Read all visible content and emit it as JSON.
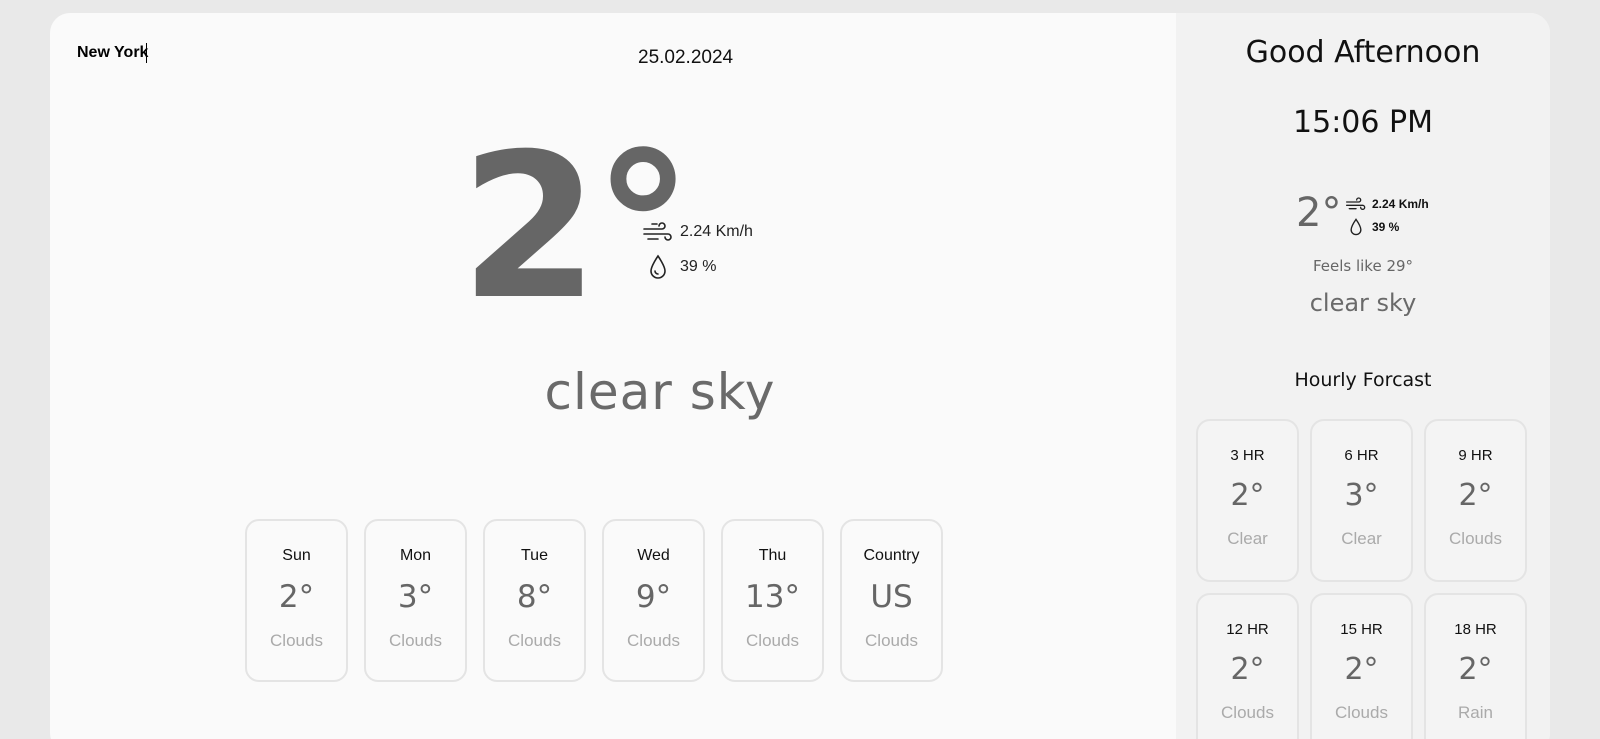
{
  "search": {
    "value": "New York"
  },
  "date": "25.02.2024",
  "current": {
    "temperature": "2°",
    "wind": "2.24 Km/h",
    "humidity": "39 %",
    "description": "clear sky"
  },
  "daily": [
    {
      "label": "Sun",
      "temp": "2°",
      "condition": "Clouds"
    },
    {
      "label": "Mon",
      "temp": "3°",
      "condition": "Clouds"
    },
    {
      "label": "Tue",
      "temp": "8°",
      "condition": "Clouds"
    },
    {
      "label": "Wed",
      "temp": "9°",
      "condition": "Clouds"
    },
    {
      "label": "Thu",
      "temp": "13°",
      "condition": "Clouds"
    },
    {
      "label": "Country",
      "temp": "US",
      "condition": "Clouds"
    }
  ],
  "sidebar": {
    "greeting": "Good Afternoon",
    "time": "15:06 PM",
    "temperature": "2°",
    "wind": "2.24 Km/h",
    "humidity": "39 %",
    "feels_like": "Feels like 29°",
    "description": "clear sky",
    "hourly_title": "Hourly Forcast"
  },
  "hourly": [
    {
      "label": "3 HR",
      "temp": "2°",
      "condition": "Clear"
    },
    {
      "label": "6 HR",
      "temp": "3°",
      "condition": "Clear"
    },
    {
      "label": "9 HR",
      "temp": "2°",
      "condition": "Clouds"
    },
    {
      "label": "12 HR",
      "temp": "2°",
      "condition": "Clouds"
    },
    {
      "label": "15 HR",
      "temp": "2°",
      "condition": "Clouds"
    },
    {
      "label": "18 HR",
      "temp": "2°",
      "condition": "Rain"
    }
  ],
  "icons": {
    "wind": "wind-icon",
    "humidity": "water-drop-icon"
  },
  "colors": {
    "page_bg": "#e9e9e9",
    "panel_bg": "#fafafa",
    "sidebar_bg": "#f2f2f2",
    "muted_text": "#666666",
    "card_border": "#e4e4e4"
  }
}
